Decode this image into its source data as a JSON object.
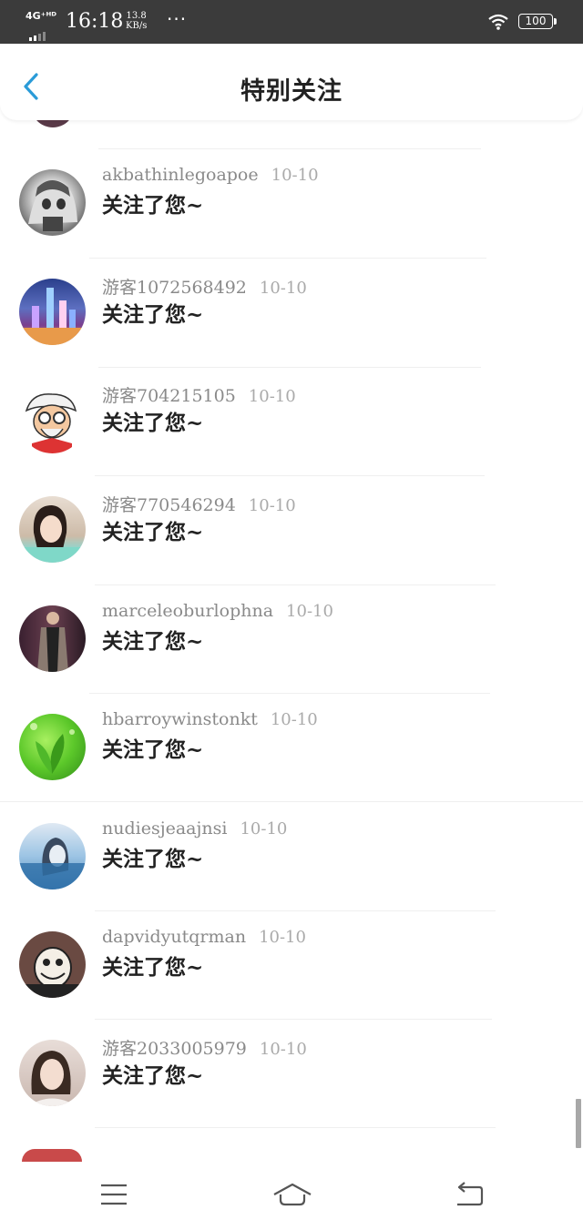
{
  "status_bar": {
    "network": "4G⁺ᴴᴰ",
    "time": "16:18",
    "speed_value": "13.8",
    "speed_unit": "KB/s",
    "more": "···",
    "battery": "100"
  },
  "header": {
    "title": "特别关注",
    "back_icon": "chevron-left-icon"
  },
  "colors": {
    "accent": "#2a9bd8",
    "status_bar_bg": "#3b3b3b",
    "name_text": "#8a8a8a",
    "date_text": "#aaaaaa"
  },
  "notifications": [
    {
      "name": "akbathinlegoapoe",
      "date": "10-10",
      "message": "关注了您~",
      "avatar": "anime-avatar-icon"
    },
    {
      "name": "游客1072568492",
      "date": "10-10",
      "message": "关注了您~",
      "avatar": "city-night-avatar-icon"
    },
    {
      "name": "游客704215105",
      "date": "10-10",
      "message": "关注了您~",
      "avatar": "cartoon-colonel-avatar-icon"
    },
    {
      "name": "游客770546294",
      "date": "10-10",
      "message": "关注了您~",
      "avatar": "woman-photo-avatar-icon"
    },
    {
      "name": "marceleoburlophna",
      "date": "10-10",
      "message": "关注了您~",
      "avatar": "man-coat-avatar-icon"
    },
    {
      "name": "hbarroywinstonkt",
      "date": "10-10",
      "message": "关注了您~",
      "avatar": "green-leaf-avatar-icon"
    },
    {
      "name": "nudiesjeaajnsi",
      "date": "10-10",
      "message": "关注了您~",
      "avatar": "blue-girl-avatar-icon"
    },
    {
      "name": "dapvidyutqrman",
      "date": "10-10",
      "message": "关注了您~",
      "avatar": "cartoon-face-avatar-icon"
    },
    {
      "name": "游客2033005979",
      "date": "10-10",
      "message": "关注了您~",
      "avatar": "woman-portrait-avatar-icon"
    }
  ],
  "nav_bar": {
    "menu_icon": "menu-icon",
    "home_icon": "home-icon",
    "back_icon": "back-icon"
  }
}
